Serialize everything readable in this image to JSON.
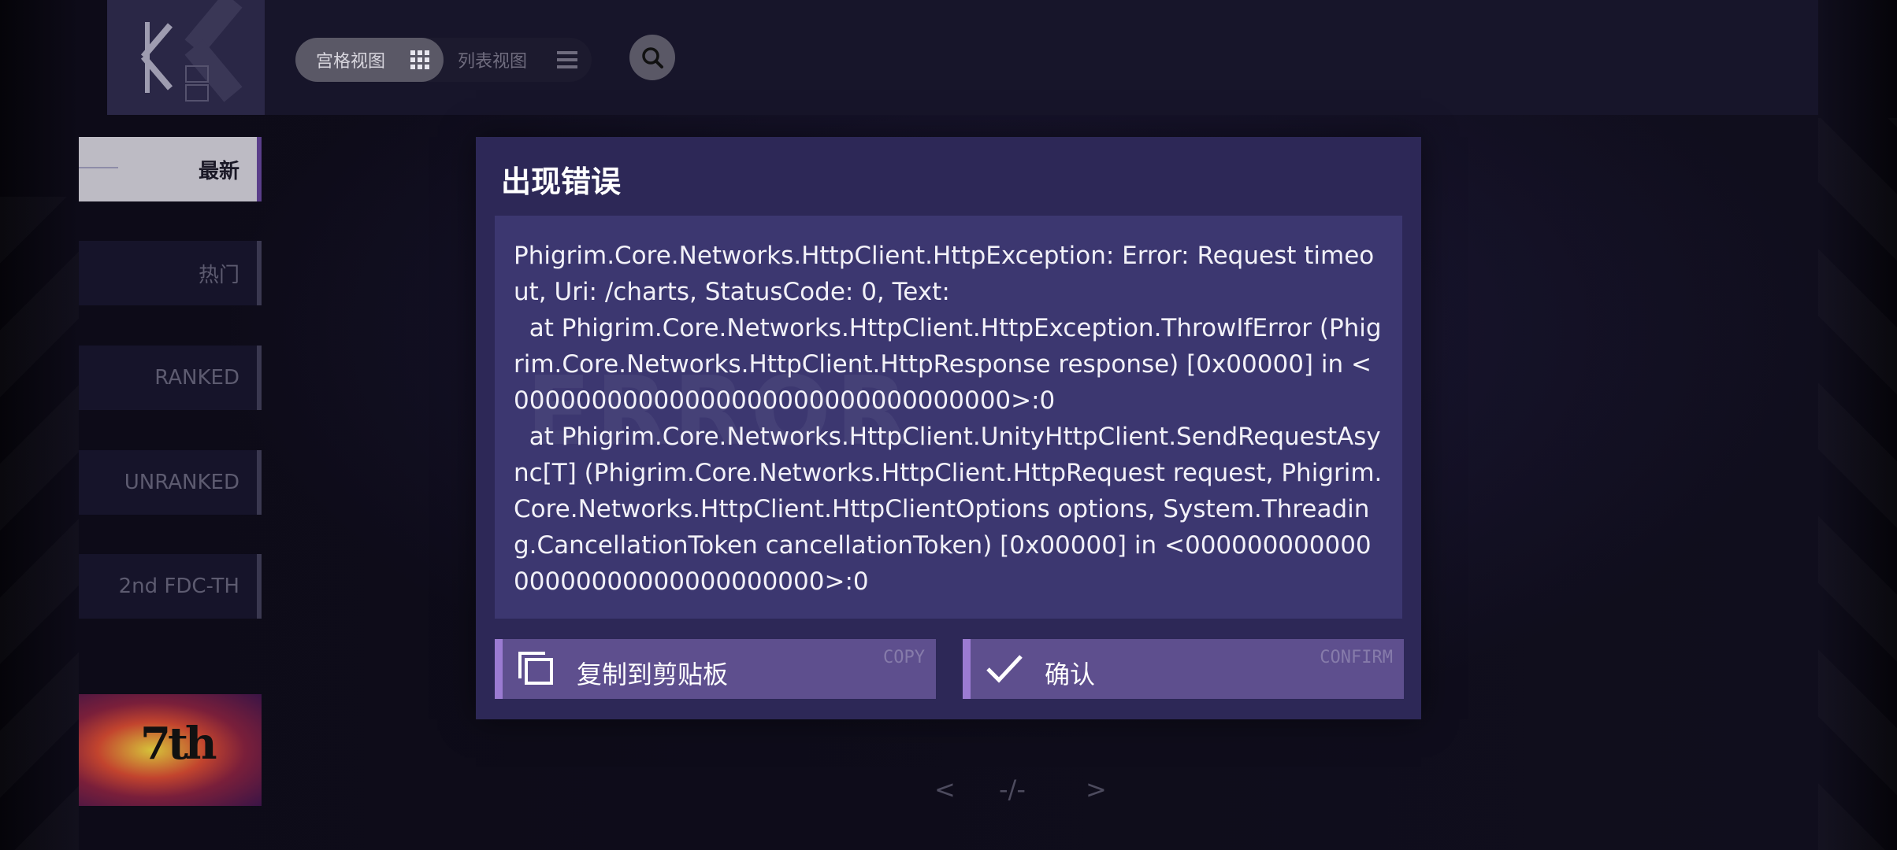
{
  "header": {
    "grid_view_label": "宫格视图",
    "list_view_label": "列表视图"
  },
  "sidebar": {
    "items": [
      {
        "label": "最新",
        "active": true
      },
      {
        "label": "热门",
        "active": false
      },
      {
        "label": "RANKED",
        "active": false
      },
      {
        "label": "UNRANKED",
        "active": false
      },
      {
        "label": "2nd FDC-TH",
        "active": false
      }
    ],
    "thumbnail_label": "7th"
  },
  "pagination": {
    "prev": "<",
    "indicator": "-/-",
    "next": ">"
  },
  "dialog": {
    "title": "出现错误",
    "watermark": "ERROR",
    "message": "Phigrim.Core.Networks.HttpClient.HttpException: Error: Request timeout, Uri: /charts, StatusCode: 0, Text:\n  at Phigrim.Core.Networks.HttpClient.HttpException.ThrowIfError (Phigrim.Core.Networks.HttpClient.HttpResponse response) [0x00000] in <00000000000000000000000000000000>:0\n  at Phigrim.Core.Networks.HttpClient.UnityHttpClient.SendRequestAsync[T] (Phigrim.Core.Networks.HttpClient.HttpRequest request, Phigrim.Core.Networks.HttpClient.HttpClientOptions options, System.Threading.CancellationToken cancellationToken) [0x00000] in <00000000000000000000000000000000>:0",
    "copy_button": {
      "label": "复制到剪贴板",
      "deco": "COPY"
    },
    "confirm_button": {
      "label": "确认",
      "deco": "CONFIRM"
    }
  },
  "colors": {
    "dialog_bg": "#2d2857",
    "error_box_bg": "#3c3770",
    "button_bg": "#5e4f8e",
    "button_accent": "#9b7bd2"
  }
}
